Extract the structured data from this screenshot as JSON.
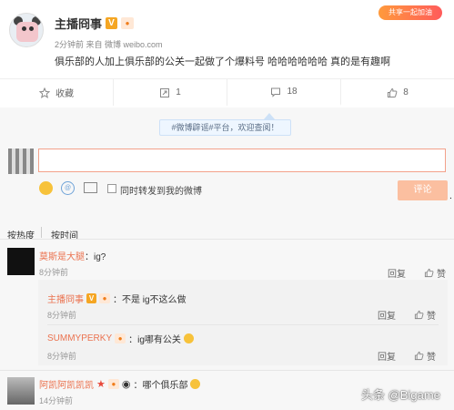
{
  "post": {
    "author": "主播冏事",
    "verified_badge": "V",
    "level_badge": "lv",
    "meta": "2分钟前 来自 微博 weibo.com",
    "text": "俱乐部的人加上俱乐部的公关一起做了个爆料号 哈哈哈哈哈哈 真的是有趣啊",
    "corner_tag": "共享一起加油"
  },
  "actions": {
    "collect": "收藏",
    "forward": "1",
    "comment": "18",
    "like": "8"
  },
  "notice": "#微博辟谣#平台，欢迎查阅！",
  "composer": {
    "placeholder": "",
    "at_label": "@",
    "forward_label": "同时转发到我的微博",
    "submit_label": "评论"
  },
  "sort": {
    "hot": "按热度",
    "time": "按时间"
  },
  "comments": [
    {
      "user": "莫斯是大腿",
      "text": "：ig?",
      "time": "8分钟前",
      "reply": "回复",
      "like": "赞",
      "replies": [
        {
          "user": "主播冏事",
          "badges": "V lv",
          "text": "：不是 ig不这么做",
          "time": "8分钟前",
          "reply": "回复",
          "like": "赞"
        },
        {
          "user": "SUMMYPERKY",
          "badges": "lv",
          "text": "：ig哪有公关",
          "time": "8分钟前",
          "reply": "回复",
          "like": "赞"
        }
      ]
    },
    {
      "user": "阿凯阿凯凯凯",
      "badges": "★ lv",
      "text": "：哪个俱乐部",
      "time": "14分钟前",
      "reply": "回复",
      "like": "赞"
    }
  ],
  "watermark": "头条 @Bigame",
  "colors": {
    "accent": "#eb7350",
    "submit": "#fbbfa0",
    "input_border": "#f3a18a"
  }
}
